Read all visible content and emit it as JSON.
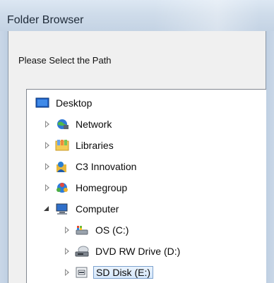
{
  "window": {
    "title": "Folder Browser"
  },
  "dialog": {
    "prompt": "Please Select the Path"
  },
  "tree": {
    "root": {
      "label": "Desktop",
      "icon": "desktop-icon"
    },
    "items": [
      {
        "label": "Network",
        "icon": "network-icon",
        "expanded": false
      },
      {
        "label": "Libraries",
        "icon": "libraries-icon",
        "expanded": false
      },
      {
        "label": "C3 Innovation",
        "icon": "user-folder-icon",
        "expanded": false
      },
      {
        "label": "Homegroup",
        "icon": "homegroup-icon",
        "expanded": false
      },
      {
        "label": "Computer",
        "icon": "computer-icon",
        "expanded": true
      },
      {
        "label": "OS (C:)",
        "icon": "system-drive-icon",
        "expanded": false
      },
      {
        "label": "DVD RW Drive (D:)",
        "icon": "dvd-drive-icon",
        "expanded": false
      },
      {
        "label": "SD Disk (E:)",
        "icon": "sd-card-icon",
        "expanded": false,
        "selected": true
      }
    ]
  },
  "colors": {
    "selection": "#d5e7fb",
    "selection_border": "#7da2ce",
    "titlebar": "#cfdcea"
  }
}
